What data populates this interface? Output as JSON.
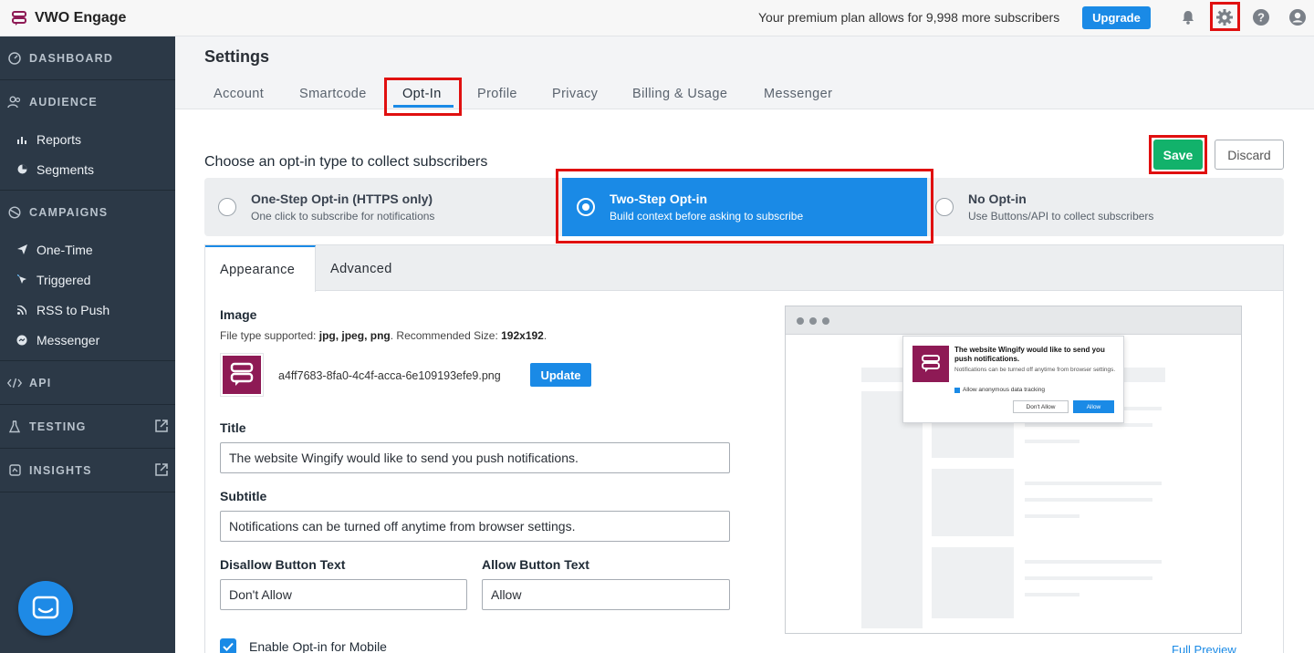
{
  "app": {
    "name": "VWO Engage",
    "brand_color": "#8e1a55"
  },
  "topbar": {
    "plan_text": "Your premium plan allows for 9,998 more subscribers",
    "upgrade_label": "Upgrade",
    "icons": [
      "bell-icon",
      "gear-icon",
      "help-icon",
      "user-icon"
    ]
  },
  "sidebar": {
    "dashboard": "DASHBOARD",
    "audience": "AUDIENCE",
    "audience_items": [
      "Reports",
      "Segments"
    ],
    "campaigns": "CAMPAIGNS",
    "campaign_items": [
      "One-Time",
      "Triggered",
      "RSS to Push",
      "Messenger"
    ],
    "api": "API",
    "testing": "TESTING",
    "insights": "INSIGHTS"
  },
  "settings": {
    "title": "Settings",
    "tabs": [
      "Account",
      "Smartcode",
      "Opt-In",
      "Profile",
      "Privacy",
      "Billing & Usage",
      "Messenger"
    ],
    "active_tab": "Opt-In"
  },
  "optin": {
    "heading": "Choose an opt-in type to collect subscribers",
    "save_label": "Save",
    "discard_label": "Discard",
    "types": [
      {
        "title": "One-Step Opt-in (HTTPS only)",
        "subtitle": "One click to subscribe for notifications"
      },
      {
        "title": "Two-Step Opt-in",
        "subtitle": "Build context before asking to subscribe"
      },
      {
        "title": "No Opt-in",
        "subtitle": "Use Buttons/API to collect subscribers"
      }
    ],
    "selected_type": "Two-Step Opt-in"
  },
  "panel": {
    "tabs": [
      "Appearance",
      "Advanced"
    ],
    "active_tab": "Appearance",
    "image_label": "Image",
    "image_help_prefix": "File type supported: ",
    "image_help_types": "jpg, jpeg, png",
    "image_help_mid": ". Recommended Size: ",
    "image_help_size": "192x192",
    "image_help_suffix": ".",
    "image_filename": "a4ff7683-8fa0-4c4f-acca-6e109193efe9.png",
    "update_label": "Update",
    "title_label": "Title",
    "title_value": "The website Wingify would like to send you push notifications.",
    "subtitle_label": "Subtitle",
    "subtitle_value": "Notifications can be turned off anytime from browser settings.",
    "disallow_label": "Disallow Button Text",
    "disallow_value": "Don't Allow",
    "allow_label": "Allow Button Text",
    "allow_value": "Allow",
    "mobile_label": "Enable Opt-in for Mobile",
    "mobile_checked": true
  },
  "preview": {
    "popup_title": "The website Wingify would like to send you push notifications.",
    "popup_subtitle": "Notifications can be turned off anytime from browser settings.",
    "popup_check": "Allow anonymous data tracking",
    "popup_disallow": "Don't Allow",
    "popup_allow": "Allow",
    "full_preview_label": "Full Preview"
  },
  "colors": {
    "accent": "#1a8ae6",
    "save": "#12b26b",
    "sidebar": "#2c3947",
    "highlight": "#e01010"
  }
}
